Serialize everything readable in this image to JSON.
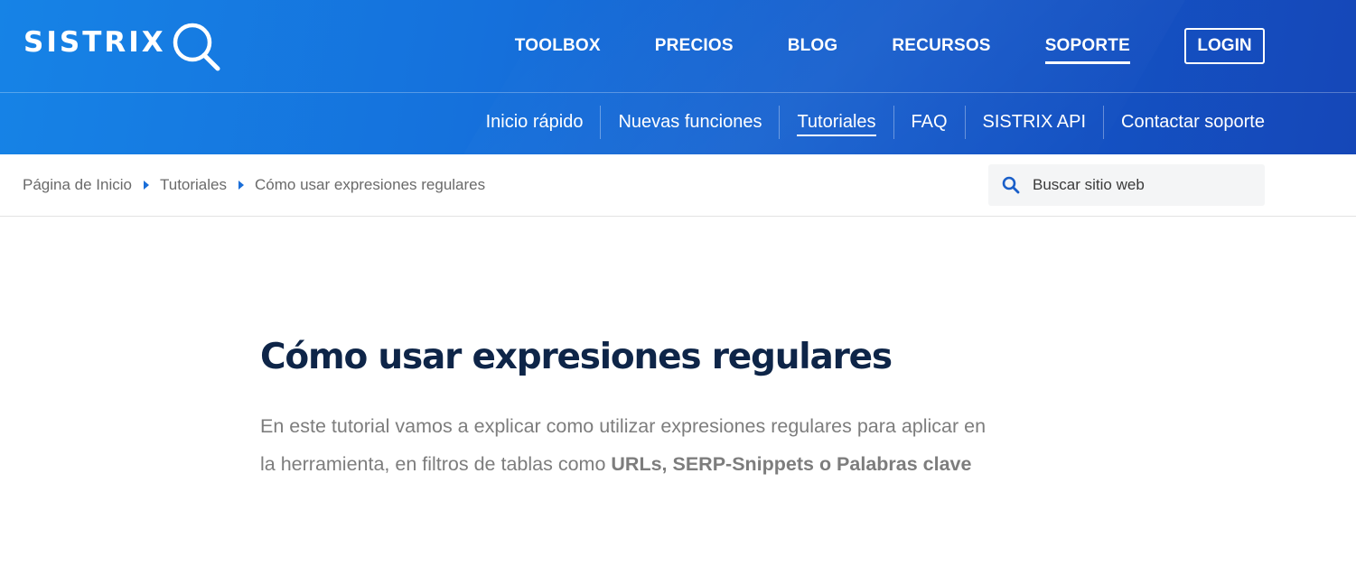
{
  "brand": {
    "name": "SISTRIX"
  },
  "main_nav": {
    "items": [
      {
        "label": "TOOLBOX",
        "active": false
      },
      {
        "label": "PRECIOS",
        "active": false
      },
      {
        "label": "BLOG",
        "active": false
      },
      {
        "label": "RECURSOS",
        "active": false
      },
      {
        "label": "SOPORTE",
        "active": true
      }
    ],
    "login_label": "LOGIN"
  },
  "sub_nav": {
    "items": [
      {
        "label": "Inicio rápido",
        "active": false
      },
      {
        "label": "Nuevas funciones",
        "active": false
      },
      {
        "label": "Tutoriales",
        "active": true
      },
      {
        "label": "FAQ",
        "active": false
      },
      {
        "label": "SISTRIX API",
        "active": false
      },
      {
        "label": "Contactar soporte",
        "active": false
      }
    ]
  },
  "breadcrumb": {
    "items": [
      "Página de Inicio",
      "Tutoriales",
      "Cómo usar expresiones regulares"
    ]
  },
  "search": {
    "placeholder": "Buscar sitio web"
  },
  "article": {
    "title": "Cómo usar expresiones regulares",
    "intro_prefix": "En este tutorial vamos a explicar como utilizar expresiones regulares para aplicar en la herramienta, en filtros de tablas como ",
    "intro_bold": "URLs, SERP-Snippets o Palabras clave"
  },
  "colors": {
    "header_start": "#1683e6",
    "header_end": "#1547b8",
    "title": "#0e2548",
    "breadcrumb_arrow": "#1a6ed8"
  }
}
